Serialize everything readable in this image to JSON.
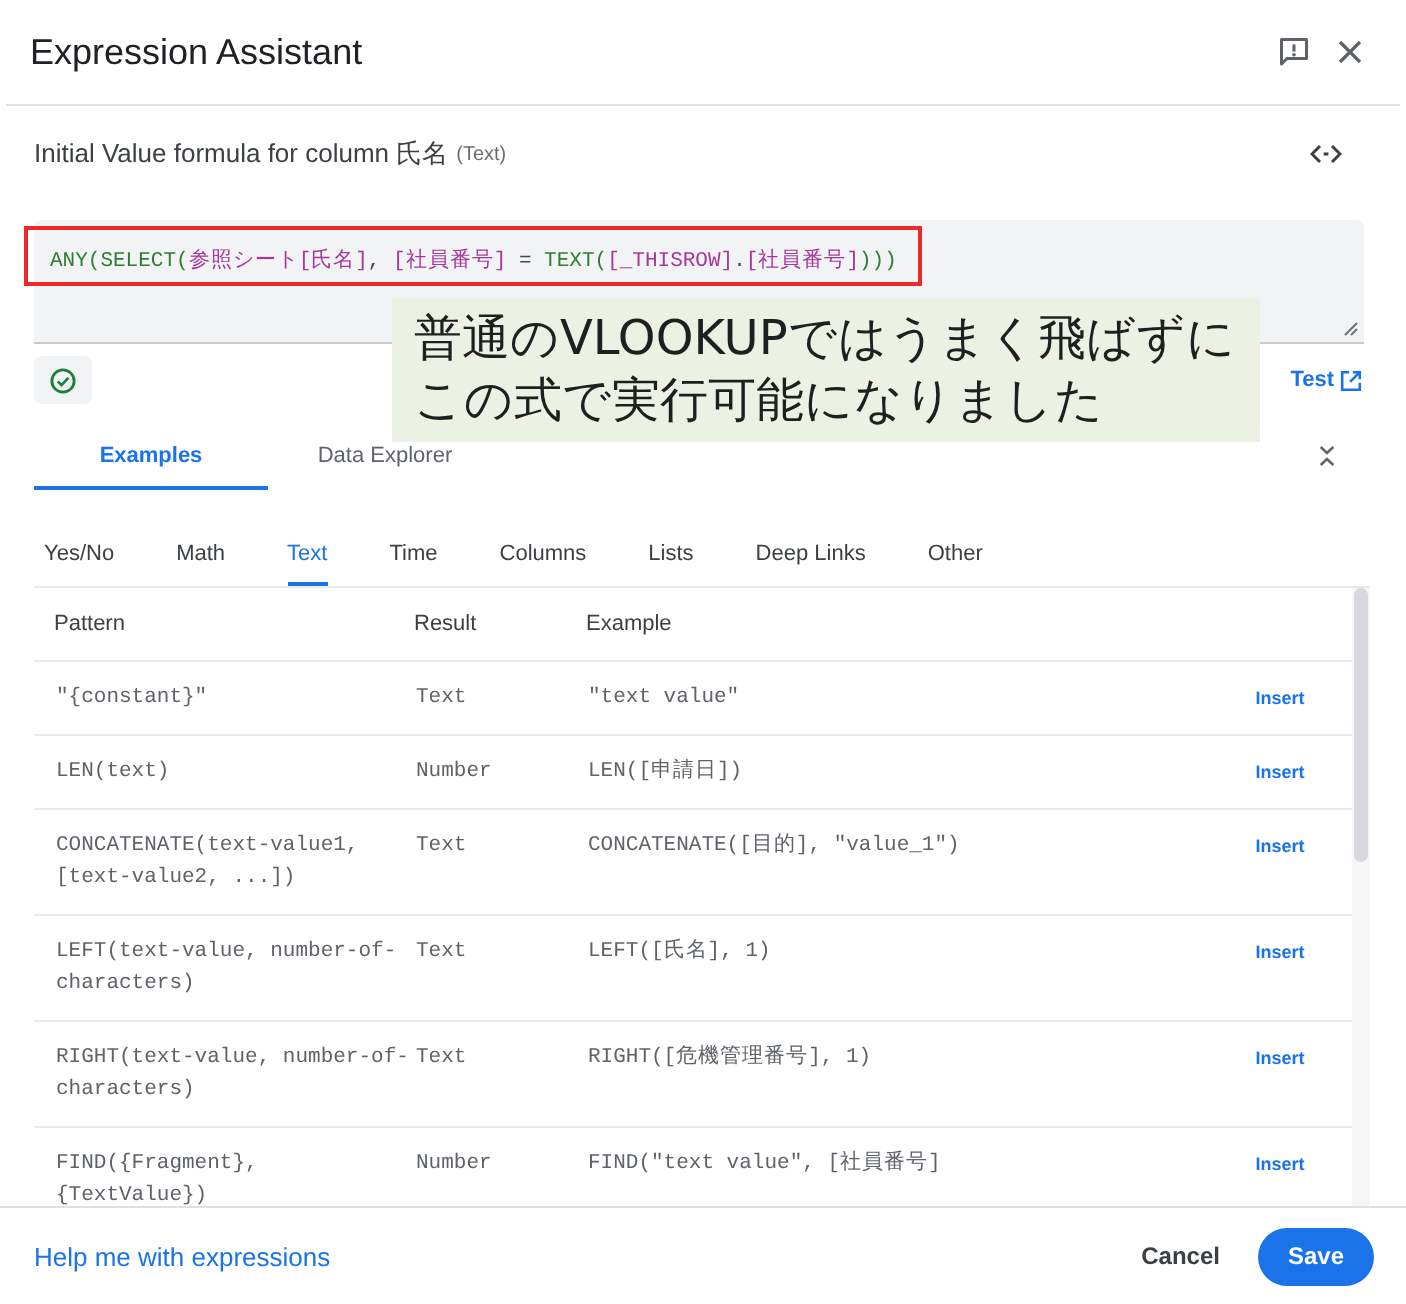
{
  "dialog": {
    "title": "Expression Assistant"
  },
  "subtitle": {
    "text": "Initial Value formula for column 氏名",
    "type": "(Text)"
  },
  "formula": {
    "tokens": [
      {
        "kind": "function",
        "text": "ANY(SELECT("
      },
      {
        "kind": "column",
        "text": "参照シート[氏名]"
      },
      {
        "kind": "plain",
        "text": ", "
      },
      {
        "kind": "column",
        "text": "[社員番号]"
      },
      {
        "kind": "plain",
        "text": " = "
      },
      {
        "kind": "function",
        "text": "TEXT("
      },
      {
        "kind": "column",
        "text": "[_THISROW]"
      },
      {
        "kind": "plain",
        "text": "."
      },
      {
        "kind": "column",
        "text": "[社員番号]"
      },
      {
        "kind": "function",
        "text": ")))"
      }
    ]
  },
  "annotation": {
    "lines": [
      "普通のVLOOKUPではうまく飛ばずに",
      "この式で実行可能になりました"
    ]
  },
  "validation": {
    "valid": true
  },
  "test_link": {
    "label": "Test"
  },
  "tabs": [
    {
      "label": "Examples",
      "selected": true
    },
    {
      "label": "Data Explorer",
      "selected": false
    }
  ],
  "categories": [
    {
      "label": "Yes/No",
      "selected": false
    },
    {
      "label": "Math",
      "selected": false
    },
    {
      "label": "Text",
      "selected": true
    },
    {
      "label": "Time",
      "selected": false
    },
    {
      "label": "Columns",
      "selected": false
    },
    {
      "label": "Lists",
      "selected": false
    },
    {
      "label": "Deep Links",
      "selected": false
    },
    {
      "label": "Other",
      "selected": false
    }
  ],
  "table": {
    "columns": [
      "Pattern",
      "Result",
      "Example"
    ],
    "rows": [
      {
        "pattern": "\"{constant}\"",
        "result": "Text",
        "example": "\"text value\"",
        "button": "Insert"
      },
      {
        "pattern": "LEN(text)",
        "result": "Number",
        "example": "LEN([申請日])",
        "button": "Insert"
      },
      {
        "pattern": "CONCATENATE(text-value1, [text-value2, ...])",
        "result": "Text",
        "example": "CONCATENATE([目的], \"value_1\")",
        "button": "Insert"
      },
      {
        "pattern": "LEFT(text-value, number-of-characters)",
        "result": "Text",
        "example": "LEFT([氏名], 1)",
        "button": "Insert"
      },
      {
        "pattern": "RIGHT(text-value, number-of-characters)",
        "result": "Text",
        "example": "RIGHT([危機管理番号], 1)",
        "button": "Insert"
      },
      {
        "pattern": "FIND({Fragment}, {TextValue})",
        "result": "Number",
        "example": "FIND(\"text value\", [社員番号]",
        "button": "Insert"
      }
    ]
  },
  "footer": {
    "help_link": "Help me with expressions",
    "buttons": [
      {
        "label": "Cancel",
        "kind": "secondary"
      },
      {
        "label": "Save",
        "kind": "primary"
      }
    ]
  }
}
